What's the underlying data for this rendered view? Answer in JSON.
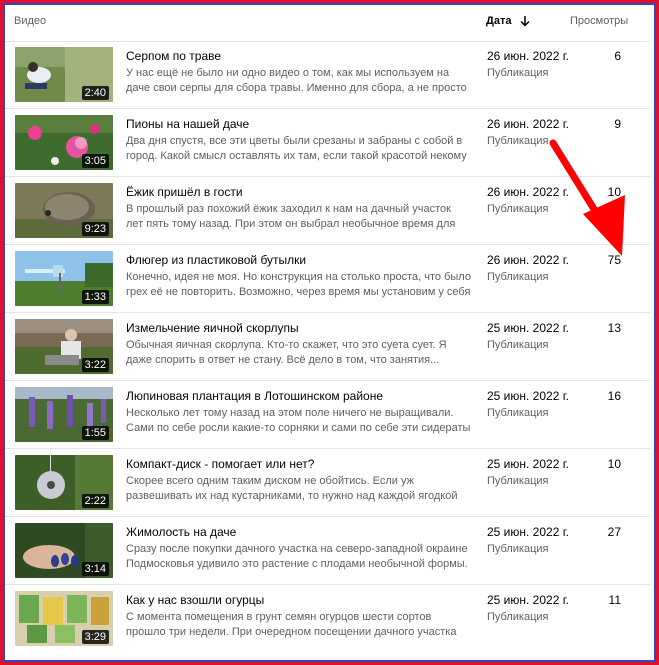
{
  "header": {
    "video_label": "Видео",
    "date_label": "Дата",
    "views_label": "Просмотры"
  },
  "rows": [
    {
      "title": "Серпом по траве",
      "description": "У нас ещё не было ни одно видео о том, как мы используем на даче свои серпы для сбора травы. Именно для сбора, а не просто удаления,...",
      "duration": "2:40",
      "date": "26 июн. 2022 г.",
      "status": "Публикация",
      "views": "6"
    },
    {
      "title": "Пионы на нашей даче",
      "description": "Два дня спустя, все эти цветы были срезаны и забраны с собой в город. Какой смысл оставлять их там, если такой красотой некому будет...",
      "duration": "3:05",
      "date": "26 июн. 2022 г.",
      "status": "Публикация",
      "views": "9"
    },
    {
      "title": "Ёжик пришёл в гости",
      "description": "В прошлый раз похожий ёжик заходил к нам на дачный участок лет пять тому назад. При этом он выбрал необычное время для своего...",
      "duration": "9:23",
      "date": "26 июн. 2022 г.",
      "status": "Публикация",
      "views": "10"
    },
    {
      "title": "Флюгер из пластиковой бутылки",
      "description": "Конечно, идея не моя. Но конструкция на столько проста, что было грех её не повторить. Возможно, через время мы установим у себя на...",
      "duration": "1:33",
      "date": "26 июн. 2022 г.",
      "status": "Публикация",
      "views": "75"
    },
    {
      "title": "Измельчение яичной скорлупы",
      "description": "Обычная яичная скорлупа. Кто-то скажет, что это суета сует. Я даже спорить в ответ не стану. Всё дело в том, что занятия...",
      "duration": "3:22",
      "date": "25 июн. 2022 г.",
      "status": "Публикация",
      "views": "13"
    },
    {
      "title": "Люпиновая плантация в Лотошинском районе",
      "description": "Несколько лет тому назад на этом поле ничего не выращивали. Сами по себе росли какие-то сорняки и сами по себе эти сидераты - люпины...",
      "duration": "1:55",
      "date": "25 июн. 2022 г.",
      "status": "Публикация",
      "views": "16"
    },
    {
      "title": "Компакт-диск - помогает или нет?",
      "description": "Скорее всего одним таким диском не обойтись. Если уж развешивать их над кустарниками, то нужно над каждой ягодкой повесить. Пока м...",
      "duration": "2:22",
      "date": "25 июн. 2022 г.",
      "status": "Публикация",
      "views": "10"
    },
    {
      "title": "Жимолость на даче",
      "description": "Сразу после покупки дачного участка на северо-западной окраине Подмосковья удивило это растение с плодами необычной формы. А...",
      "duration": "3:14",
      "date": "25 июн. 2022 г.",
      "status": "Публикация",
      "views": "27"
    },
    {
      "title": "Как у нас взошли огурцы",
      "description": "С момента помещения в грунт семян огурцов шести сортов прошло три недели. При очередном посещении дачного участка мы проверили...",
      "duration": "3:29",
      "date": "25 июн. 2022 г.",
      "status": "Публикация",
      "views": "11"
    }
  ],
  "colors": {
    "frame_outer": "#e0102a",
    "frame_inner": "#2d47c9",
    "annotation_arrow": "#ff0000"
  }
}
